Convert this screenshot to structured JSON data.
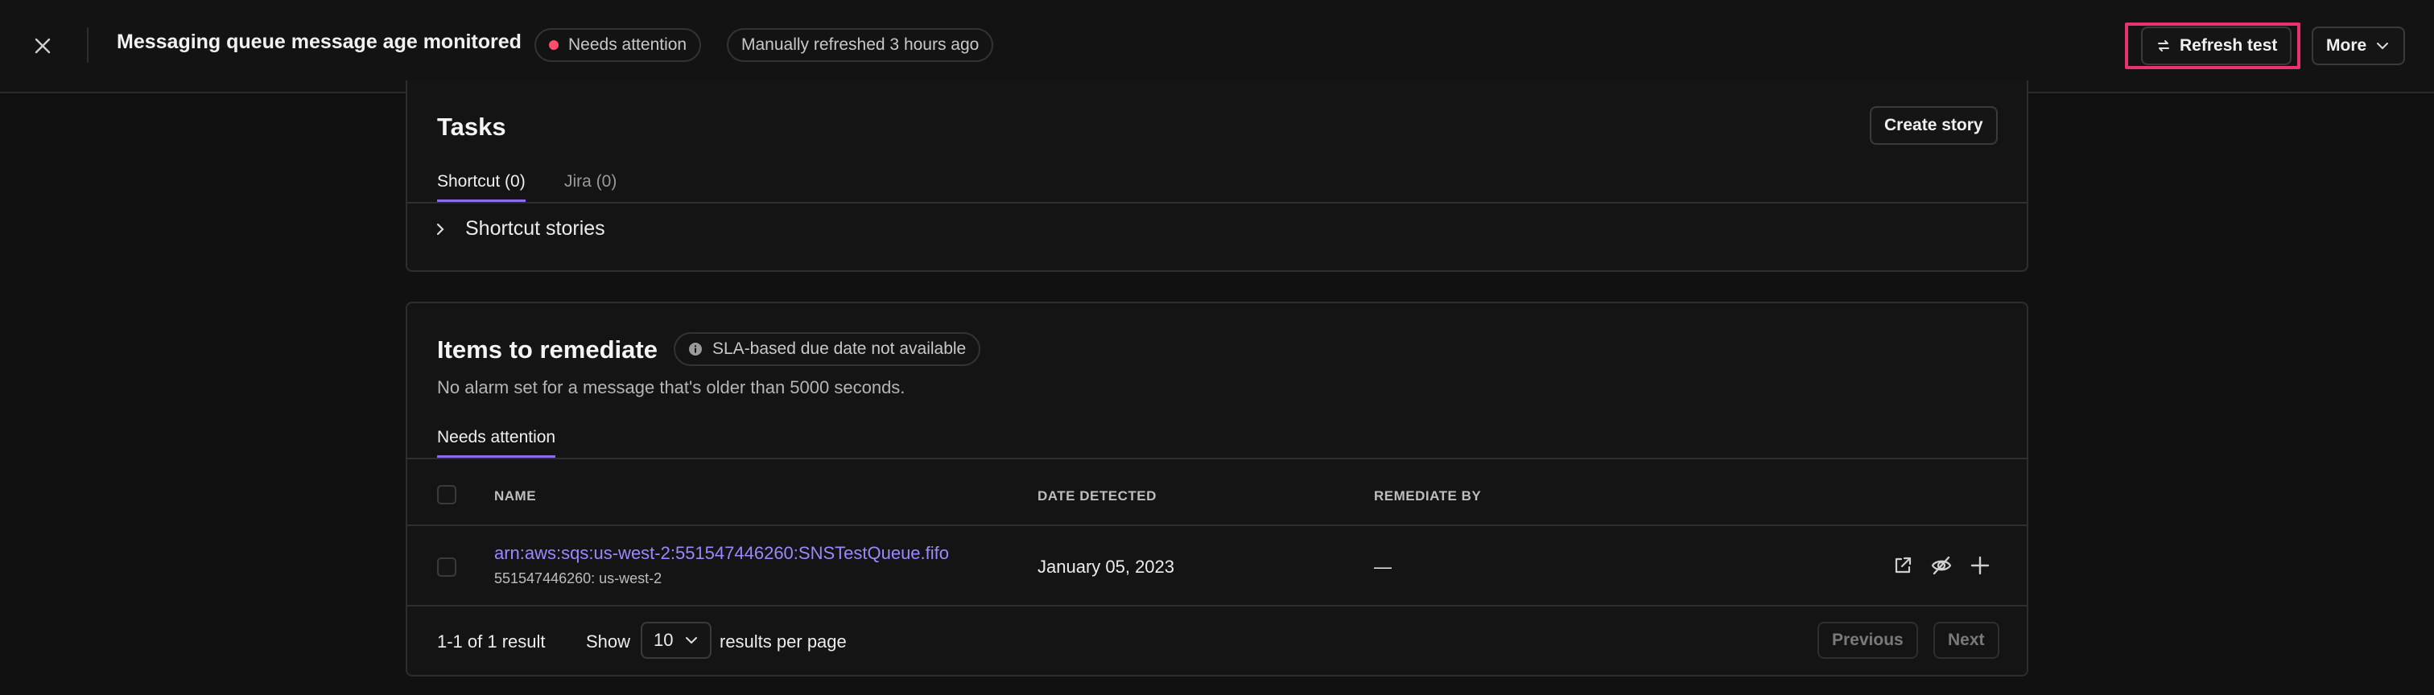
{
  "header": {
    "title": "Messaging queue message age monitored",
    "status_badge": "Needs attention",
    "status_color": "#ff4d6d",
    "refresh_info": "Manually refreshed 3 hours ago",
    "refresh_button": "Refresh test",
    "more_button": "More"
  },
  "tasks": {
    "title": "Tasks",
    "create_story_button": "Create story",
    "tabs": [
      {
        "label": "Shortcut (0)",
        "active": true
      },
      {
        "label": "Jira (0)",
        "active": false
      }
    ],
    "section_label": "Shortcut stories"
  },
  "remediate": {
    "title": "Items to remediate",
    "sla_badge": "SLA-based due date not available",
    "description": "No alarm set for a message that's older than 5000 seconds.",
    "tab": "Needs attention",
    "columns": [
      "NAME",
      "DATE DETECTED",
      "REMEDIATE BY"
    ],
    "rows": [
      {
        "name": "arn:aws:sqs:us-west-2:551547446260:SNSTestQueue.fifo",
        "sub": "551547446260: us-west-2",
        "date_detected": "January 05, 2023",
        "remediate_by": "—"
      }
    ],
    "pagination": {
      "result_text": "1-1 of 1 result",
      "show_label": "Show",
      "per_page_value": "10",
      "per_page_label": "results per page",
      "previous": "Previous",
      "next": "Next"
    }
  },
  "accent_color": "#8b6cf0",
  "link_color": "#9f86ff"
}
